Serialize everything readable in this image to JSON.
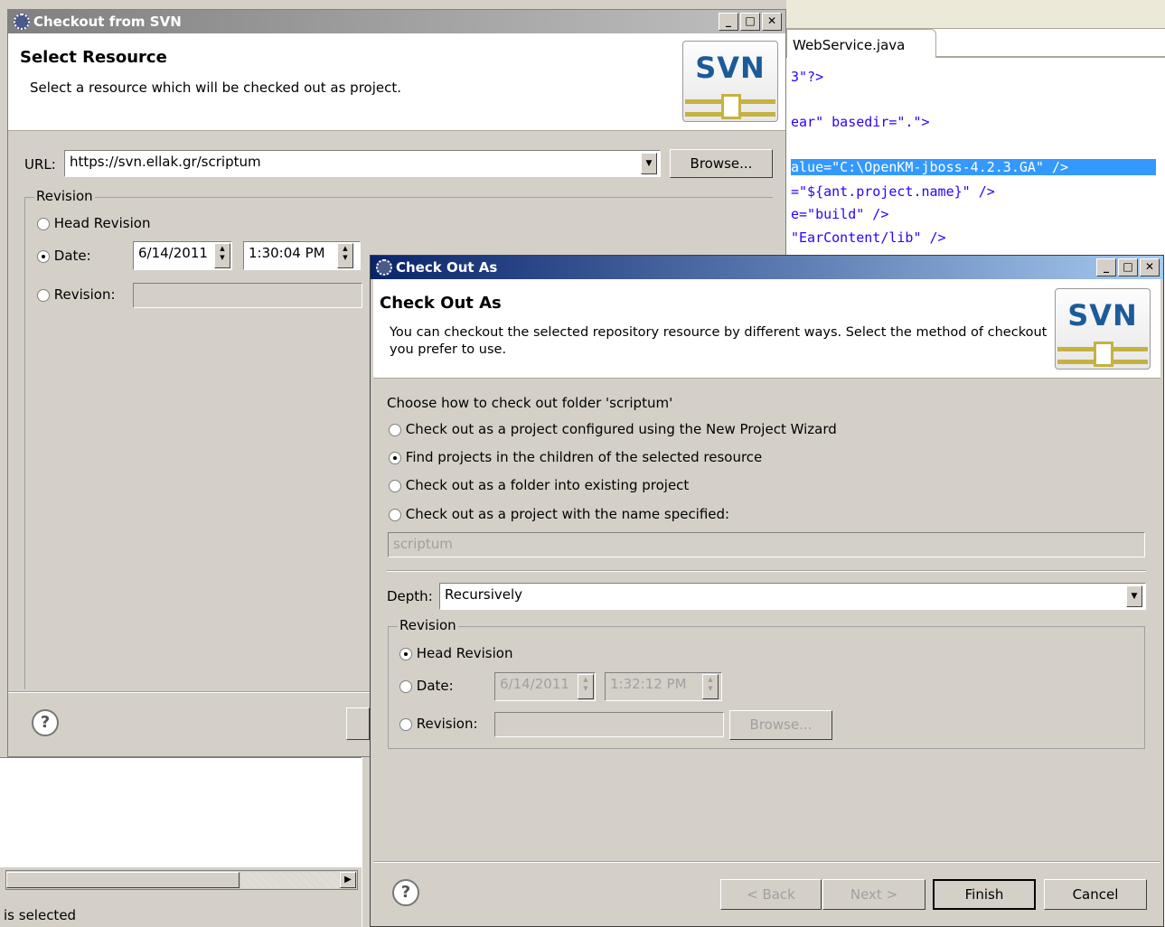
{
  "editor": {
    "tab_label": "WebService.java",
    "lines": [
      "3\"?>",
      "ear\" basedir=\".\">",
      "alue=\"C:\\OpenKM-jboss-4.2.3.GA\" />",
      "=\"${ant.project.name}\" />",
      "e=\"build\" />",
      "\"EarContent/lib\" />"
    ]
  },
  "behind": {
    "status_text": "is selected"
  },
  "checkout_window": {
    "title": "Checkout from SVN",
    "header_title": "Select Resource",
    "header_desc": "Select a resource which will be checked out as project.",
    "logo_text": "SVN",
    "url_label": "URL:",
    "url_value": "https://svn.ellak.gr/scriptum",
    "browse_label": "Browse...",
    "revision_group": "Revision",
    "head_revision_label": "Head Revision",
    "date_label": "Date:",
    "date_value": "6/14/2011",
    "time_value": "1:30:04 PM",
    "revision_label": "Revision:",
    "selected_option": "date"
  },
  "checkout_as_window": {
    "title": "Check Out As",
    "header_title": "Check Out As",
    "header_desc": "You can checkout the selected repository resource by different ways. Select the method of checkout you prefer to use.",
    "logo_text": "SVN",
    "choose_label": "Choose how to check out folder 'scriptum'",
    "options": [
      "Check out as a project configured using the New Project Wizard",
      "Find projects in the children of the selected resource",
      "Check out as a folder into existing project",
      "Check out as a project with the name specified:"
    ],
    "selected_option_index": 1,
    "project_name_value": "scriptum",
    "depth_label": "Depth:",
    "depth_value": "Recursively",
    "revision_group": "Revision",
    "head_revision_label": "Head Revision",
    "date_label": "Date:",
    "date_value": "6/14/2011",
    "time_value": "1:32:12 PM",
    "revision_label": "Revision:",
    "browse_label": "Browse...",
    "back_label": "< Back",
    "next_label": "Next >",
    "finish_label": "Finish",
    "cancel_label": "Cancel"
  },
  "colors": {
    "titlebar_active": "#0a246a",
    "titlebar_inactive": "#808080",
    "selection": "#3399ff"
  }
}
